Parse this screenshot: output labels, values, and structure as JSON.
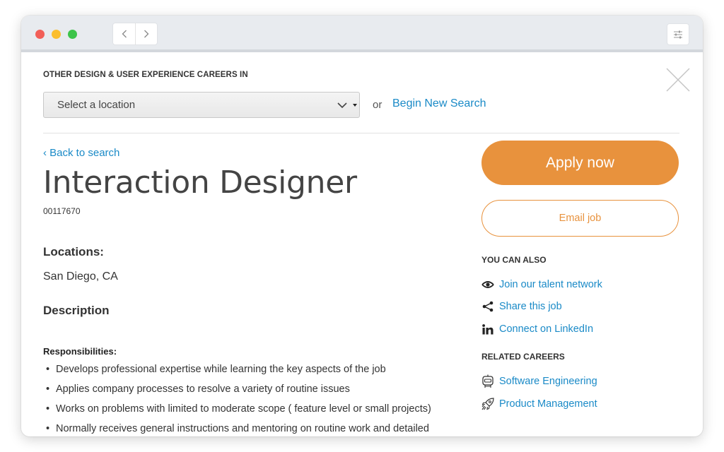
{
  "search": {
    "heading": "OTHER DESIGN & USER EXPERIENCE CAREERS IN",
    "location_select": "Select a location",
    "or": "or",
    "new_search": "Begin New Search"
  },
  "job": {
    "back_link": "‹ Back to search",
    "title": "Interaction Designer",
    "id": "00117670",
    "locations_label": "Locations:",
    "location": "San Diego, CA",
    "description_label": "Description",
    "responsibilities_label": "Responsibilities:",
    "responsibilities": [
      "Develops professional expertise while learning the key aspects of the job",
      "Applies company processes to resolve a variety of routine issues",
      "Works on problems with limited to moderate scope ( feature level or small projects)",
      "Normally receives general instructions and mentoring on routine work and detailed"
    ]
  },
  "sidebar": {
    "apply": "Apply now",
    "email": "Email job",
    "you_can_also": "YOU CAN ALSO",
    "actions": [
      {
        "label": "Join our talent network",
        "icon": "eye-icon"
      },
      {
        "label": "Share this job",
        "icon": "share-icon"
      },
      {
        "label": "Connect on LinkedIn",
        "icon": "linkedin-icon"
      }
    ],
    "related_label": "RELATED CAREERS",
    "related": [
      {
        "label": "Software Engineering",
        "icon": "robot-icon"
      },
      {
        "label": "Product Management",
        "icon": "rocket-icon"
      }
    ]
  },
  "colors": {
    "accent": "#e8923d",
    "link": "#1a8ac7"
  }
}
